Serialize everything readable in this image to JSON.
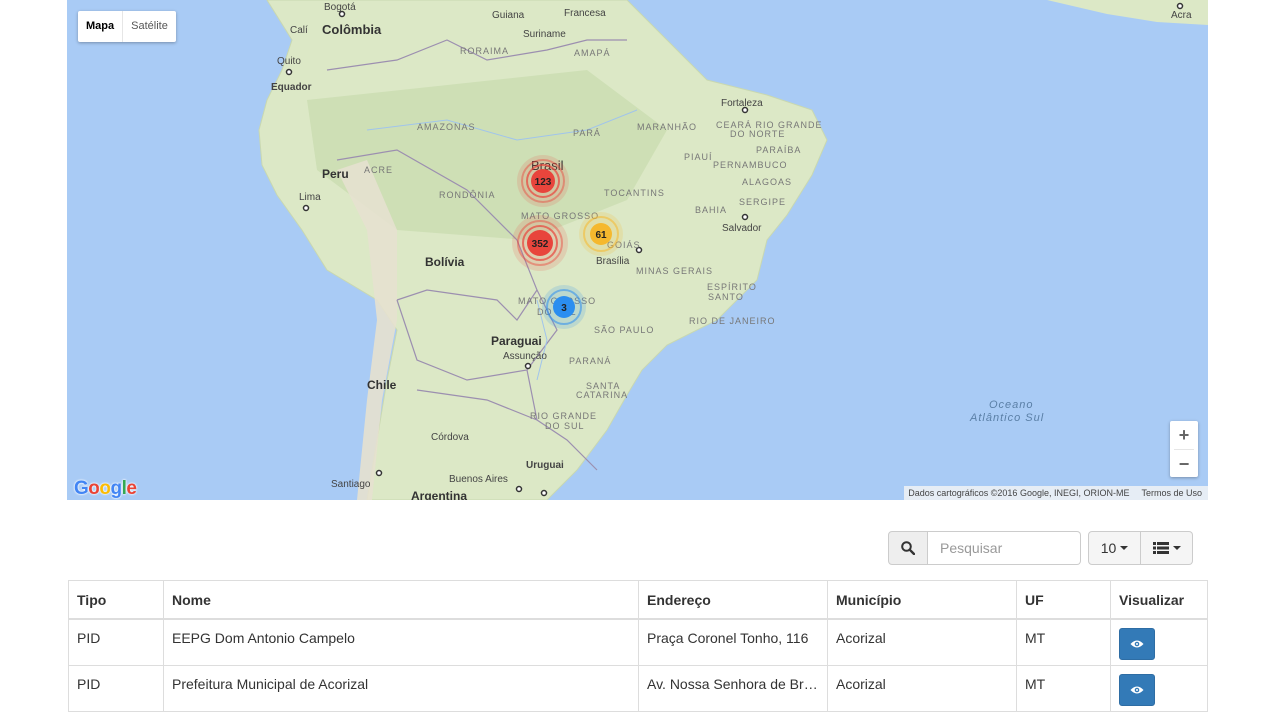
{
  "map": {
    "type_controls": {
      "map_label": "Mapa",
      "satellite_label": "Satélite"
    },
    "zoom": {
      "in": "+",
      "out": "−"
    },
    "attribution": "Dados cartográficos ©2016 Google, INEGI, ORION-ME",
    "terms": "Termos de Uso",
    "clusters": [
      {
        "count": "123",
        "color": "#e8453c"
      },
      {
        "count": "352",
        "color": "#e8453c"
      },
      {
        "count": "61",
        "color": "#f5b82e"
      },
      {
        "count": "3",
        "color": "#2b8ef0"
      }
    ],
    "labels": {
      "bogota": "Bogotá",
      "guiana": "Guiana",
      "francesa": "Francesa",
      "acra": "Acra",
      "cali": "Calí",
      "colombia": "Colômbia",
      "roraima": "RORAIMA",
      "suriname": "Suriname",
      "amapa": "AMAPÁ",
      "quito": "Quito",
      "equador": "Equador",
      "fortaleza": "Fortaleza",
      "amazonas": "AMAZONAS",
      "para": "PARÁ",
      "maranhao": "MARANHÃO",
      "ceara": "CEARÁ RIO GRANDE",
      "donorte": "DO NORTE",
      "paraiba": "PARAÍBA",
      "piaui": "PIAUÍ",
      "pernambuco": "PERNAMBUCO",
      "brasil": "Brasil",
      "peru": "Peru",
      "acre": "ACRE",
      "rondonia": "RONDÔNIA",
      "tocantins": "TOCANTINS",
      "alagoas": "ALAGOAS",
      "lima": "Lima",
      "bahia": "BAHIA",
      "sergipe": "SERGIPE",
      "matogrosso": "MATO GROSSO",
      "salvador": "Salvador",
      "goias": "GOIÁS",
      "brasilia": "Brasília",
      "bolivia": "Bolívia",
      "minas": "MINAS GERAIS",
      "espirito": "ESPÍRITO",
      "santo": "SANTO",
      "matogrossosul": "MATO GROSSO",
      "dosul": "DO SUL",
      "saopaulo": "SÃO PAULO",
      "riodejaneiro": "RIO DE JANEIRO",
      "paraguai": "Paraguai",
      "assuncao": "Assunção",
      "parana": "PARANÁ",
      "chile": "Chile",
      "santa": "SANTA",
      "catarina": "CATARINA",
      "oceano": "Oceano",
      "atlantico": "Atlântico Sul",
      "riograndedosul1": "RIO GRANDE",
      "riograndedosul2": "DO SUL",
      "cordova": "Córdova",
      "uruguai": "Uruguai",
      "buenosaires": "Buenos Aires",
      "santiago": "Santiago",
      "argentina": "Argentina"
    }
  },
  "toolbar": {
    "search_placeholder": "Pesquisar",
    "page_size": "10"
  },
  "table": {
    "headers": [
      "Tipo",
      "Nome",
      "Endereço",
      "Município",
      "UF",
      "Visualizar"
    ],
    "rows": [
      [
        "PID",
        "EEPG Dom Antonio Campelo",
        "Praça Coronel Tonho, 116",
        "Acorizal",
        "MT"
      ],
      [
        "PID",
        "Prefeitura Municipal de Acorizal",
        "Av. Nossa Senhora de Brotas",
        "Acorizal",
        "MT"
      ]
    ]
  },
  "colors": {
    "primary": "#337ab7",
    "ocean": "#a9cbf5",
    "land": "#dce8c6"
  }
}
